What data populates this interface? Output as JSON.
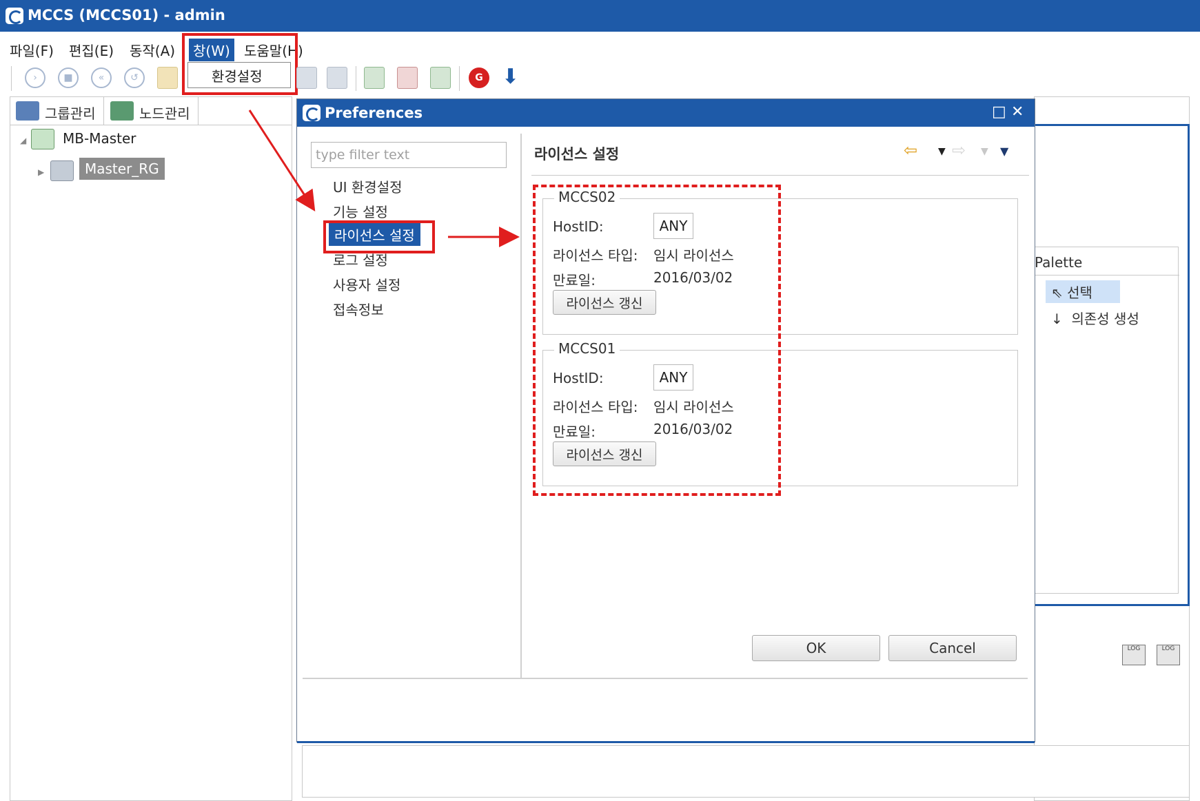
{
  "window": {
    "title": "MCCS (MCCS01) - admin"
  },
  "menu": {
    "items": [
      "파일(F)",
      "편집(E)",
      "동작(A)",
      "창(W)",
      "도움말(H)"
    ],
    "dropdown_item": "환경설정"
  },
  "left_panel": {
    "tabs": [
      "그룹관리",
      "노드관리"
    ],
    "tree": {
      "root": "MB-Master",
      "child": "Master_RG"
    }
  },
  "dialog": {
    "title": "Preferences",
    "filter_placeholder": "type filter text",
    "nav": [
      "UI 환경설정",
      "기능 설정",
      "라이선스 설정",
      "로그 설정",
      "사용자 설정",
      "접속정보"
    ],
    "selected_nav": "라이선스 설정",
    "page_title": "라이선스 설정",
    "licenses": [
      {
        "name": "MCCS02",
        "hostid_label": "HostID:",
        "hostid": "ANY",
        "type_label": "라이선스 타입:",
        "type": "임시 라이선스",
        "expiry_label": "만료일:",
        "expiry": "2016/03/02",
        "button": "라이선스 갱신"
      },
      {
        "name": "MCCS01",
        "hostid_label": "HostID:",
        "hostid": "ANY",
        "type_label": "라이선스 타입:",
        "type": "임시 라이선스",
        "expiry_label": "만료일:",
        "expiry": "2016/03/02",
        "button": "라이선스 갱신"
      }
    ],
    "ok": "OK",
    "cancel": "Cancel"
  },
  "palette": {
    "title": "Palette",
    "items": [
      "선택",
      "의존성 생성"
    ]
  },
  "colors": {
    "title_bar": "#1e5aa8",
    "highlight": "#e01e1e"
  }
}
